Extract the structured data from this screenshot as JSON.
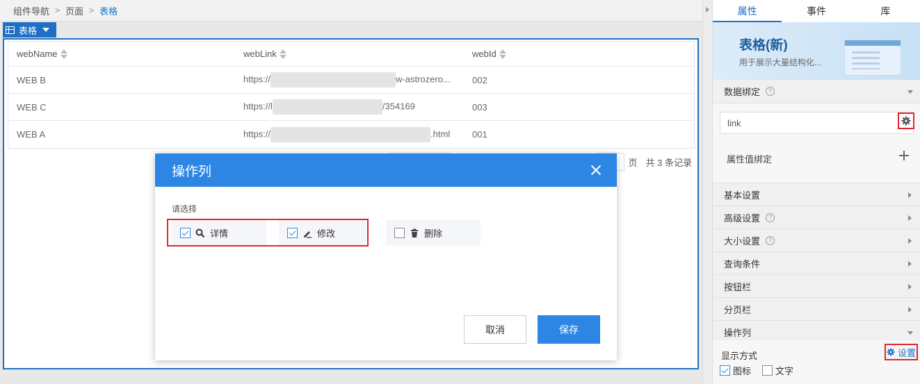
{
  "breadcrumb": [
    "组件导航",
    "页面",
    "表格"
  ],
  "component_tag": {
    "label": "表格"
  },
  "table": {
    "columns": [
      "webName",
      "webLink",
      "webId"
    ],
    "rows": [
      {
        "name": "WEB B",
        "link_start": "https://",
        "link_end": "w-astrozero...",
        "id": "002"
      },
      {
        "name": "WEB C",
        "link_start": "https://l",
        "link_end": "/354169",
        "id": "003"
      },
      {
        "name": "WEB A",
        "link_start": "https://",
        "link_end": ".html",
        "id": "001"
      }
    ]
  },
  "pager": {
    "page_suffix": "页",
    "total_text": "共 3 条记录"
  },
  "modal": {
    "title": "操作列",
    "prompt": "请选择",
    "options": [
      {
        "label": "详情",
        "checked": true,
        "icon": "search-icon"
      },
      {
        "label": "修改",
        "checked": true,
        "icon": "edit-icon"
      },
      {
        "label": "删除",
        "checked": false,
        "icon": "trash-icon"
      }
    ],
    "cancel_label": "取消",
    "save_label": "保存"
  },
  "panel": {
    "tabs": [
      "属性",
      "事件",
      "库"
    ],
    "banner": {
      "title": "表格(新)",
      "subtitle": "用于展示大量结构化..."
    },
    "data_binding": {
      "label": "数据绑定",
      "value": "link",
      "attr_bind_label": "属性值绑定"
    },
    "sections": [
      "基本设置",
      "高级设置",
      "大小设置",
      "查询条件",
      "按钮栏",
      "分页栏",
      "操作列"
    ],
    "display": {
      "label": "显示方式",
      "setting_label": "设置",
      "opt_icon": "图标",
      "opt_text": "文字"
    }
  },
  "colors": {
    "accent": "#2d86e3",
    "highlight": "#e0262c"
  }
}
